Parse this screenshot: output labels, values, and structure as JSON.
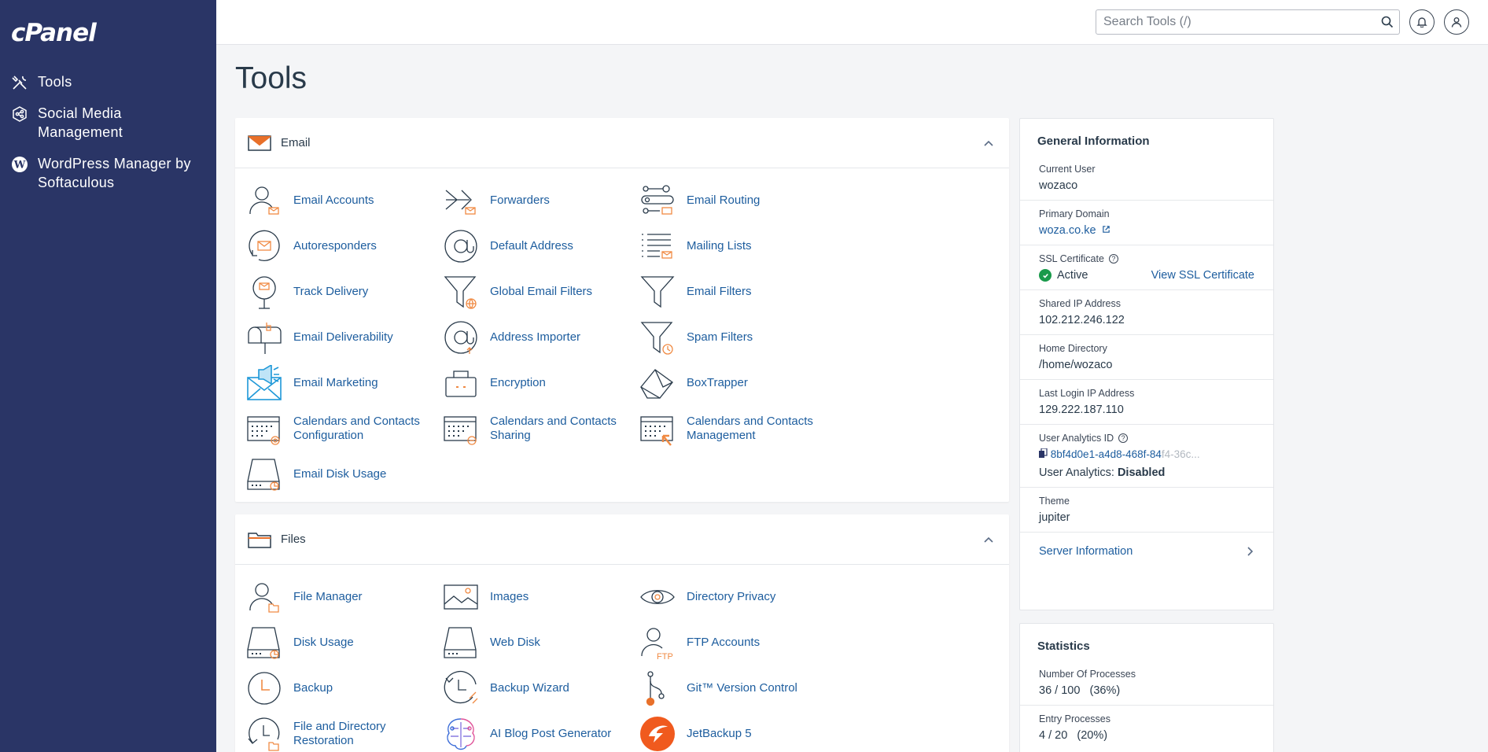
{
  "sidebar": {
    "logo": "cPanel",
    "items": [
      {
        "label": "Tools"
      },
      {
        "label": "Social Media Management"
      },
      {
        "label": "WordPress Manager by Softaculous"
      }
    ]
  },
  "header": {
    "search_placeholder": "Search Tools (/)"
  },
  "page": {
    "title": "Tools"
  },
  "email_panel": {
    "title": "Email",
    "tools": [
      "Email Accounts",
      "Forwarders",
      "Email Routing",
      "Autoresponders",
      "Default Address",
      "Mailing Lists",
      "Track Delivery",
      "Global Email Filters",
      "Email Filters",
      "Email Deliverability",
      "Address Importer",
      "Spam Filters",
      "Email Marketing",
      "Encryption",
      "BoxTrapper",
      "Calendars and Contacts Configuration",
      "Calendars and Contacts Sharing",
      "Calendars and Contacts Management",
      "Email Disk Usage"
    ]
  },
  "files_panel": {
    "title": "Files",
    "tools": [
      "File Manager",
      "Images",
      "Directory Privacy",
      "Disk Usage",
      "Web Disk",
      "FTP Accounts",
      "Backup",
      "Backup Wizard",
      "Git™ Version Control",
      "File and Directory Restoration",
      "AI Blog Post Generator",
      "JetBackup 5"
    ]
  },
  "general_info": {
    "title": "General Information",
    "current_user_label": "Current User",
    "current_user": "wozaco",
    "primary_domain_label": "Primary Domain",
    "primary_domain": "woza.co.ke",
    "ssl_label": "SSL Certificate",
    "ssl_status": "Active",
    "ssl_link": "View SSL Certificate",
    "shared_ip_label": "Shared IP Address",
    "shared_ip": "102.212.246.122",
    "home_dir_label": "Home Directory",
    "home_dir": "/home/wozaco",
    "last_login_label": "Last Login IP Address",
    "last_login": "129.222.187.110",
    "analytics_id_label": "User Analytics ID",
    "analytics_id_visible": "8bf4d0e1-a4d8-468f-84",
    "analytics_id_faded": "f4-36c...",
    "analytics_text": "User Analytics:",
    "analytics_value": "Disabled",
    "theme_label": "Theme",
    "theme": "jupiter",
    "server_info": "Server Information"
  },
  "statistics": {
    "title": "Statistics",
    "processes_label": "Number Of Processes",
    "processes_value": "36 / 100",
    "processes_pct": "(36%)",
    "entry_label": "Entry Processes",
    "entry_value": "4 / 20",
    "entry_pct": "(20%)"
  },
  "colors": {
    "sidebar": "#2a3566",
    "link": "#1d5d9e",
    "accent": "#f08a43",
    "success": "#1a9a4b"
  }
}
